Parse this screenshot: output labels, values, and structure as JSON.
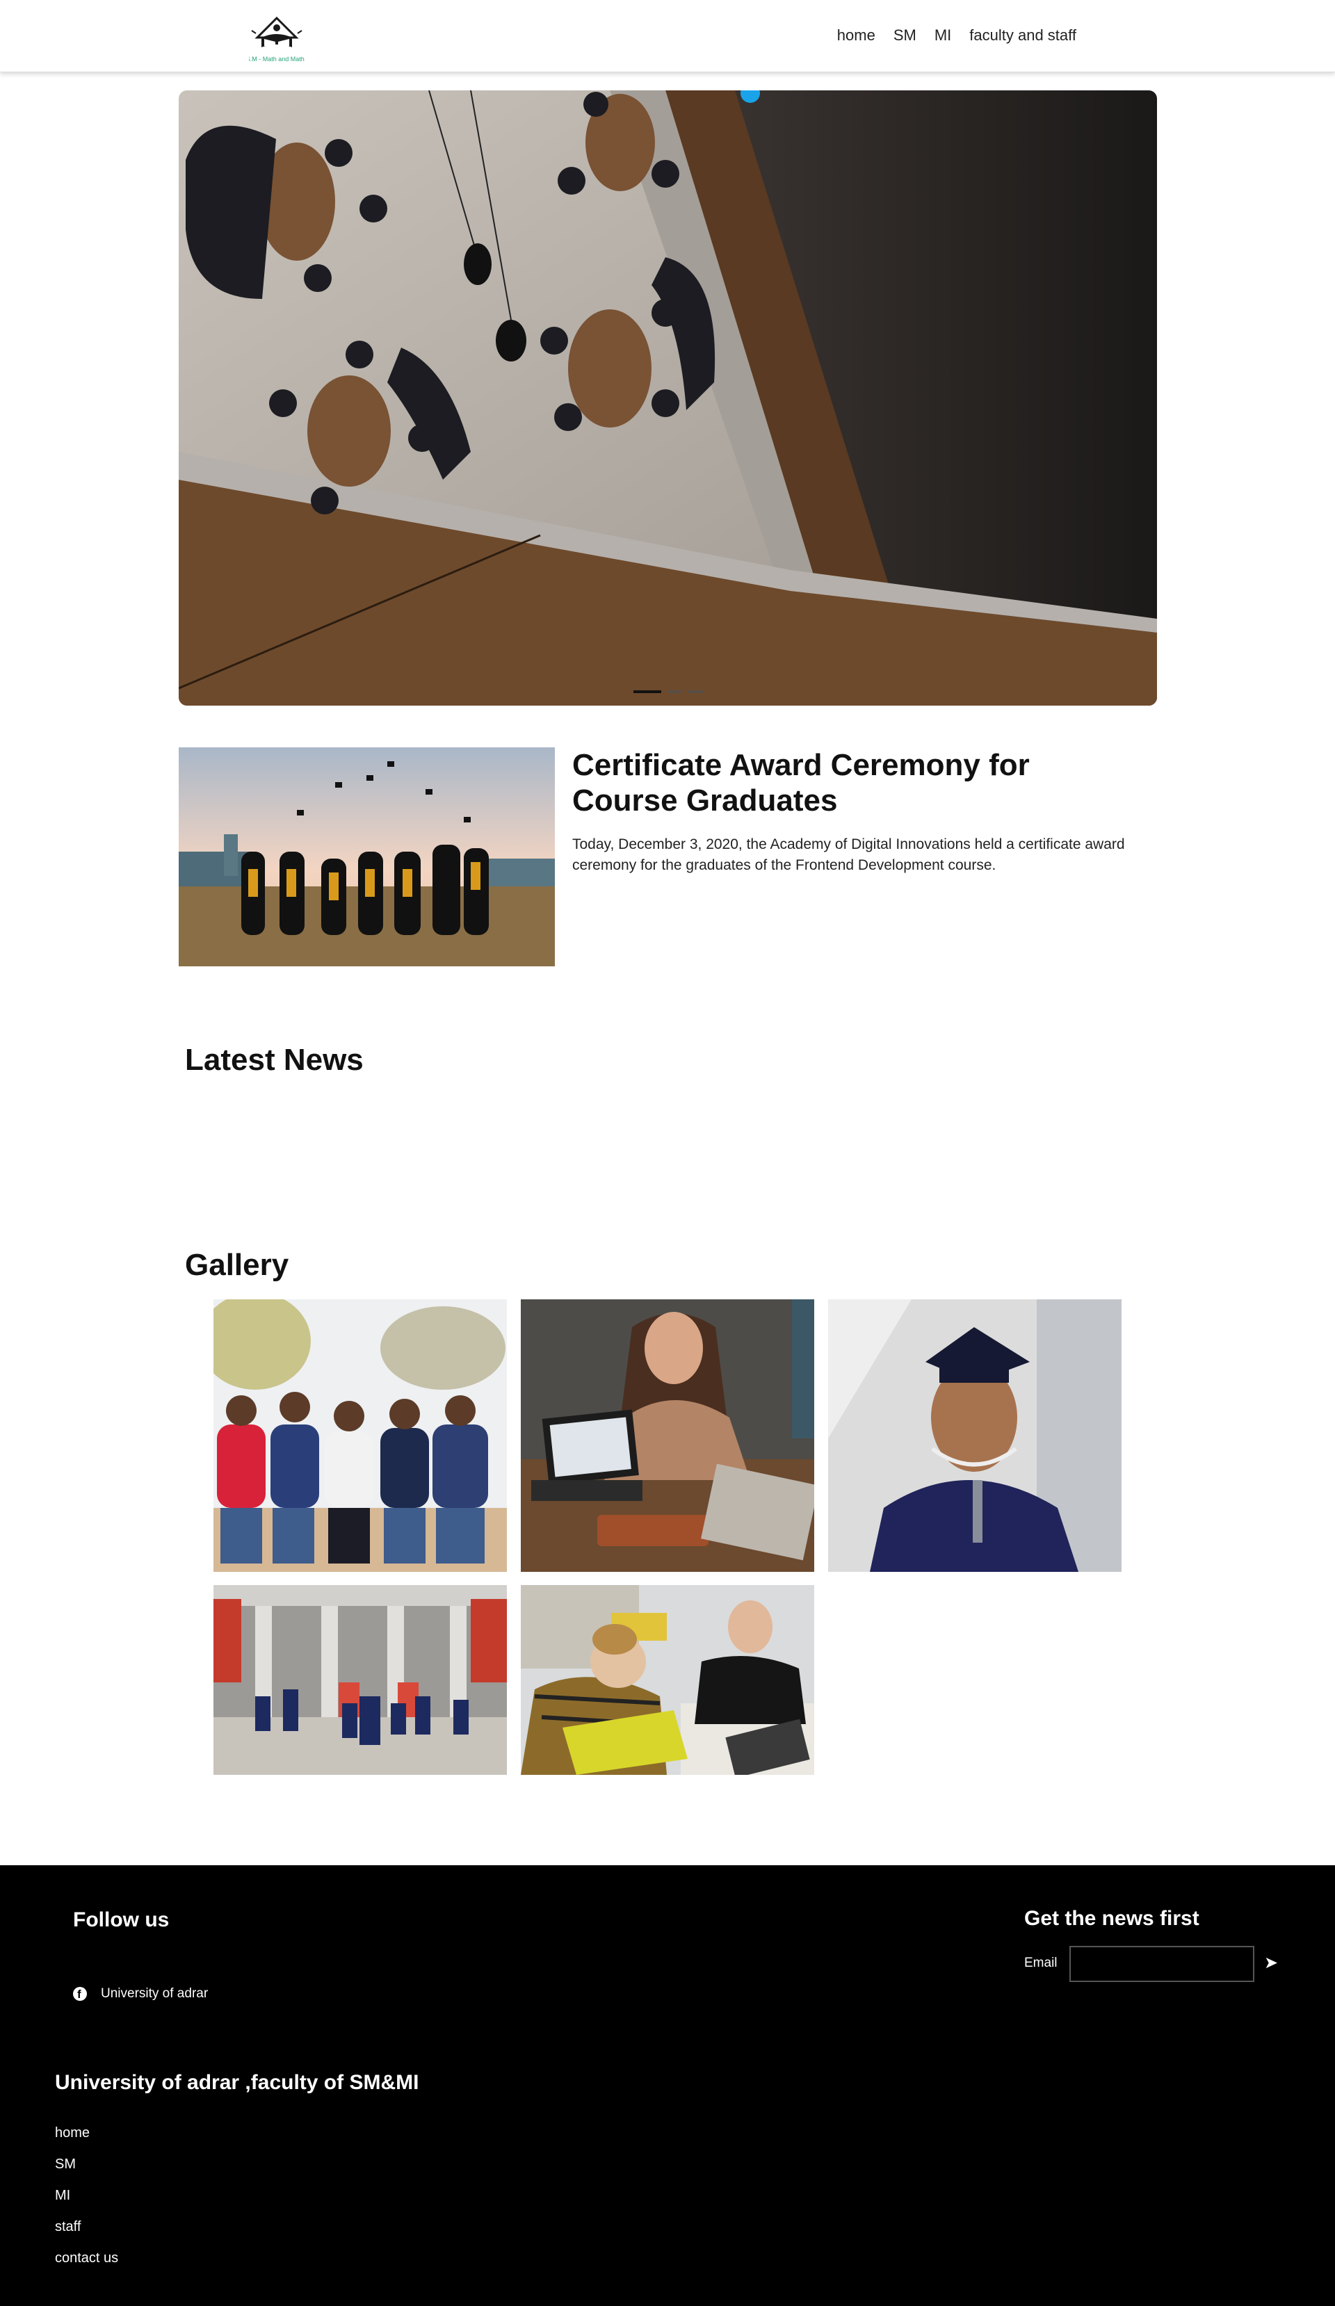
{
  "header": {
    "logo_caption": "S.M - Math and Maths",
    "nav": [
      "home",
      "SM",
      "MI",
      "faculty and staff"
    ]
  },
  "hero": {
    "slides": 3,
    "active_slide": 1
  },
  "article": {
    "title": "Certificate Award Ceremony for Course Graduates",
    "text": "Today, December 3, 2020, the Academy of Digital Innovations held a certificate award ceremony for the graduates of the Frontend Development course."
  },
  "latest_news": {
    "title": "Latest News"
  },
  "gallery": {
    "title": "Gallery"
  },
  "footer": {
    "follow_title": "Follow us",
    "facebook_label": "University of adrar",
    "news_title": "Get the news first",
    "email_label": "Email",
    "email_value": "",
    "university_title": "University of adrar ,faculty of SM&MI",
    "links": [
      "home",
      "SM",
      "MI",
      "staff",
      "contact us"
    ]
  },
  "colors": {
    "footer_bg": "#000000",
    "header_bg": "#ffffff"
  }
}
